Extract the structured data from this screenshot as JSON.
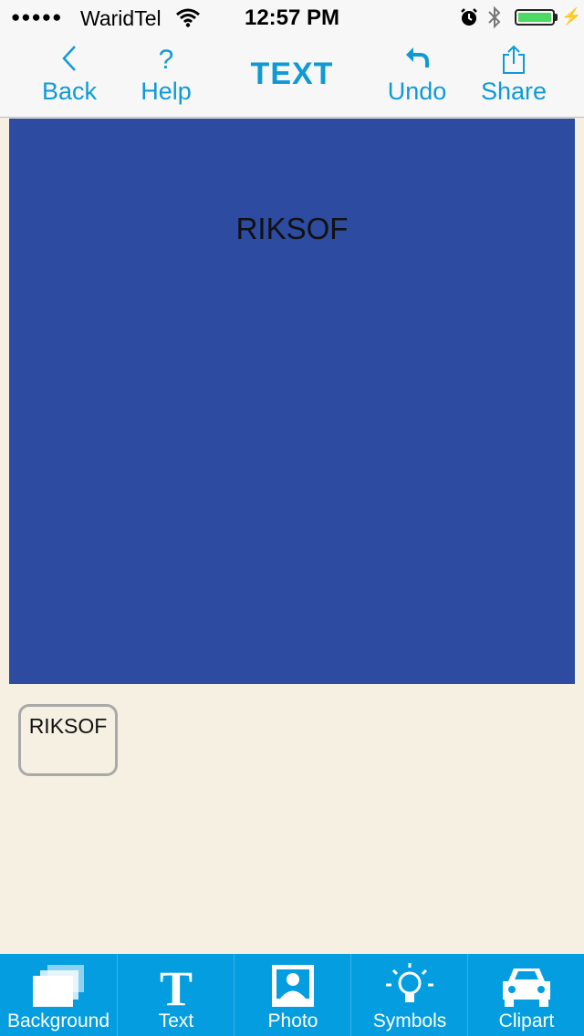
{
  "status": {
    "carrier": "WaridTel",
    "time": "12:57 PM",
    "signal_dots": "●●●●●",
    "battery_color": "#4cd964"
  },
  "nav": {
    "back_label": "Back",
    "help_label": "Help",
    "title": "TEXT",
    "undo_label": "Undo",
    "share_label": "Share",
    "accent_color": "#0f9ad6"
  },
  "canvas": {
    "background_color": "#2d4ba0",
    "text": "RIKSOF"
  },
  "layers": [
    {
      "label": "RIKSOF"
    }
  ],
  "tabs": {
    "background": "Background",
    "text": "Text",
    "photo": "Photo",
    "symbols": "Symbols",
    "clipart": "Clipart",
    "bar_color": "#049ddf"
  }
}
